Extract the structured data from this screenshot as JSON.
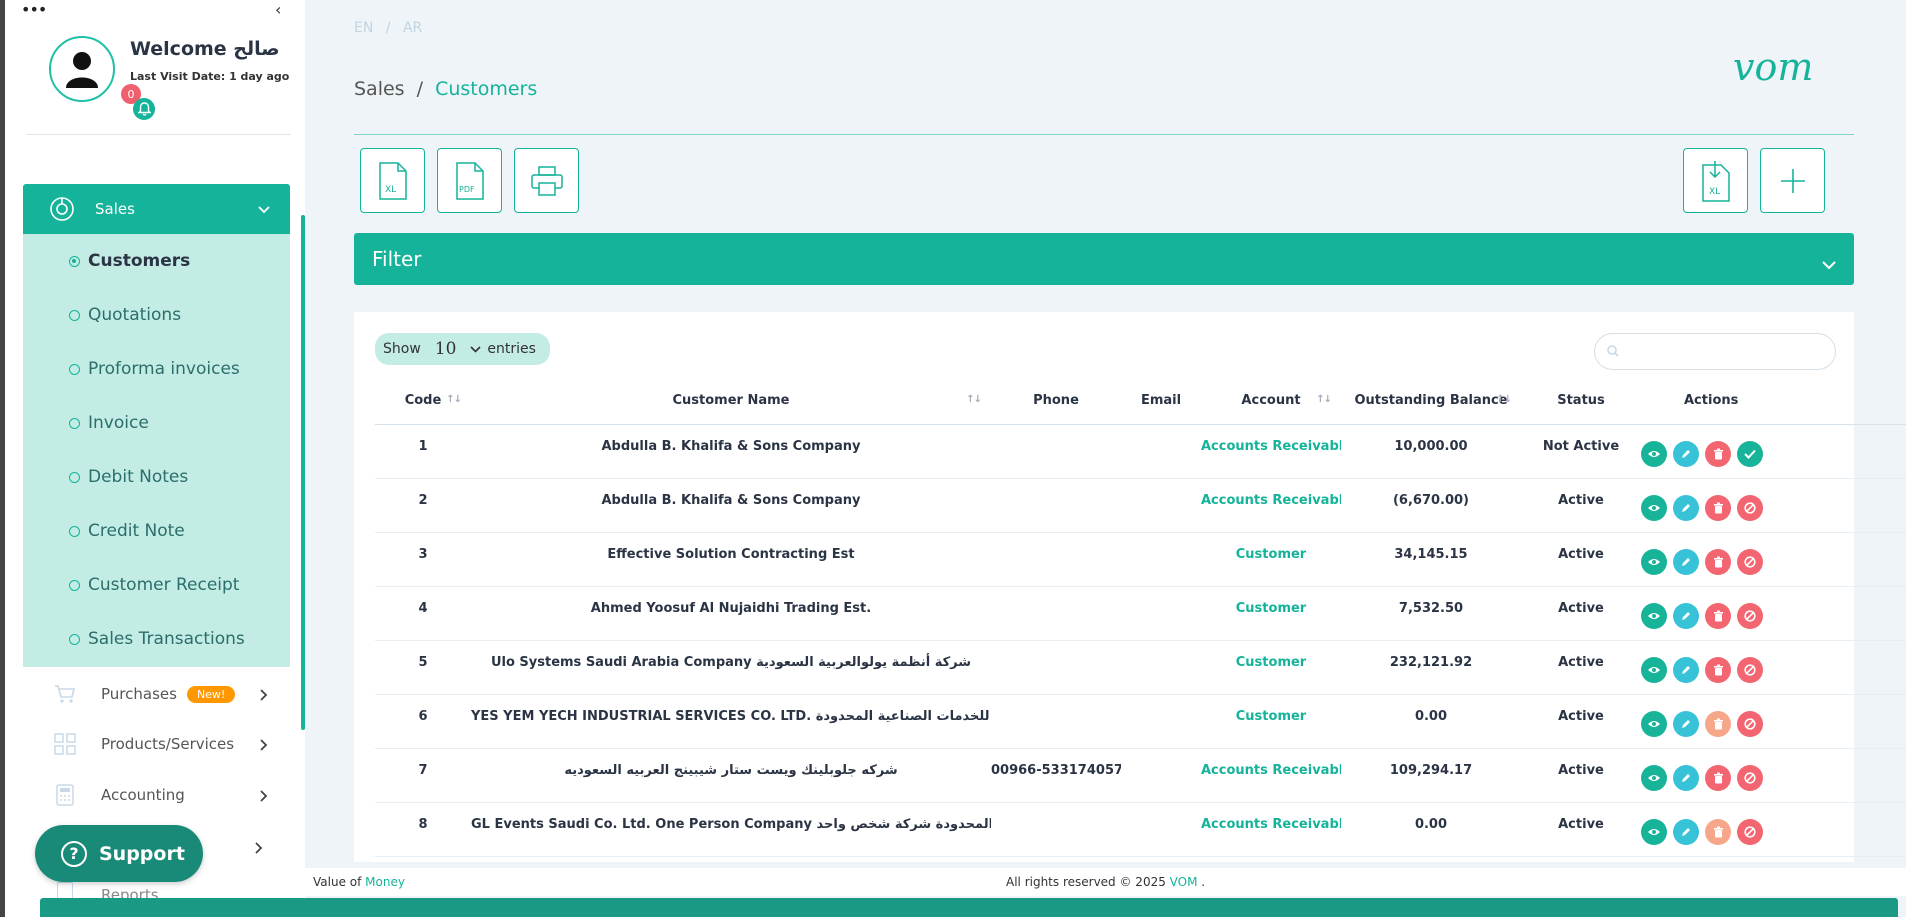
{
  "sidebar": {
    "more_label": "•••",
    "collapse_label": "‹",
    "welcome": "Welcome صالح",
    "last_visit": "Last Visit Date: 1 day ago",
    "notification_count": "0",
    "sales_label": "Sales",
    "sales_submenu": [
      {
        "label": "Customers",
        "active": true
      },
      {
        "label": "Quotations"
      },
      {
        "label": "Proforma invoices"
      },
      {
        "label": "Invoice"
      },
      {
        "label": "Debit Notes"
      },
      {
        "label": "Credit Note"
      },
      {
        "label": "Customer Receipt"
      },
      {
        "label": "Sales Transactions"
      }
    ],
    "purchases_label": "Purchases",
    "new_badge": "New!",
    "products_label": "Products/Services",
    "accounting_label": "Accounting",
    "reports_label": "Reports",
    "support_label": "Support",
    "support_icon": "?"
  },
  "header": {
    "lang_en": "EN",
    "lang_sep": "/",
    "lang_ar": "AR",
    "breadcrumb_parent": "Sales",
    "breadcrumb_sep": "/",
    "breadcrumb_current": "Customers",
    "logo_text": "vom"
  },
  "toolbar": {
    "xl_label": "XL",
    "pdf_label": "PDF",
    "import_label": "XL"
  },
  "filter": {
    "label": "Filter"
  },
  "table_controls": {
    "show_label": "Show",
    "entries_value": "10",
    "entries_label": "entries",
    "search_placeholder": ""
  },
  "table": {
    "columns": [
      "Code",
      "Customer Name",
      "Phone",
      "Email",
      "Account",
      "Outstanding Balance",
      "Status",
      "Actions"
    ],
    "rows": [
      {
        "code": "1",
        "name": "Abdulla B. Khalifa & Sons Company",
        "phone": "",
        "email": "",
        "account": "Accounts Receivables",
        "balance": "10,000.00",
        "status": "Not Active"
      },
      {
        "code": "2",
        "name": "Abdulla B. Khalifa & Sons Company",
        "phone": "",
        "email": "",
        "account": "Accounts Receivables",
        "balance": "(6,670.00)",
        "status": "Active"
      },
      {
        "code": "3",
        "name": "Effective Solution Contracting Est",
        "phone": "",
        "email": "",
        "account": "Customer",
        "balance": "34,145.15",
        "status": "Active"
      },
      {
        "code": "4",
        "name": "Ahmed Yoosuf Al Nujaidhi Trading Est.",
        "phone": "",
        "email": "",
        "account": "Customer",
        "balance": "7,532.50",
        "status": "Active"
      },
      {
        "code": "5",
        "name": "Ulo Systems Saudi Arabia Company شركة أنظمة يولوالعربية السعودية",
        "phone": "",
        "email": "",
        "account": "Customer",
        "balance": "232,121.92",
        "status": "Active"
      },
      {
        "code": "6",
        "name": "YES YEM YECH INDUSTRIAL SERVICES CO. LTD. شركة يس يم يتش للخدمات الصناعية المحدودة",
        "phone": "",
        "email": "",
        "account": "Customer",
        "balance": "0.00",
        "status": "Active"
      },
      {
        "code": "7",
        "name": "شركه جلوبلينك ويست ستار شيبينج العربيه السعوديه",
        "phone": "00966-533174057",
        "email": "",
        "account": "Accounts Receivables",
        "balance": "109,294.17",
        "status": "Active"
      },
      {
        "code": "8",
        "name": "GL Events Saudi Co. Ltd. One Person Company شركة جي ال ايفينتس السعودية المحدودة شركة شخص واحد",
        "phone": "",
        "email": "",
        "account": "Accounts Receivables",
        "balance": "0.00",
        "status": "Active"
      }
    ]
  },
  "footer": {
    "left_prefix": "Value of ",
    "left_link": "Money",
    "rights": "All rights reserved © 2025 ",
    "brand": "VOM",
    "suffix": " ."
  },
  "colors": {
    "accent": "#15b39a",
    "submenu_bg": "#c3ece5",
    "danger": "#f26571",
    "info": "#38c2d8"
  }
}
